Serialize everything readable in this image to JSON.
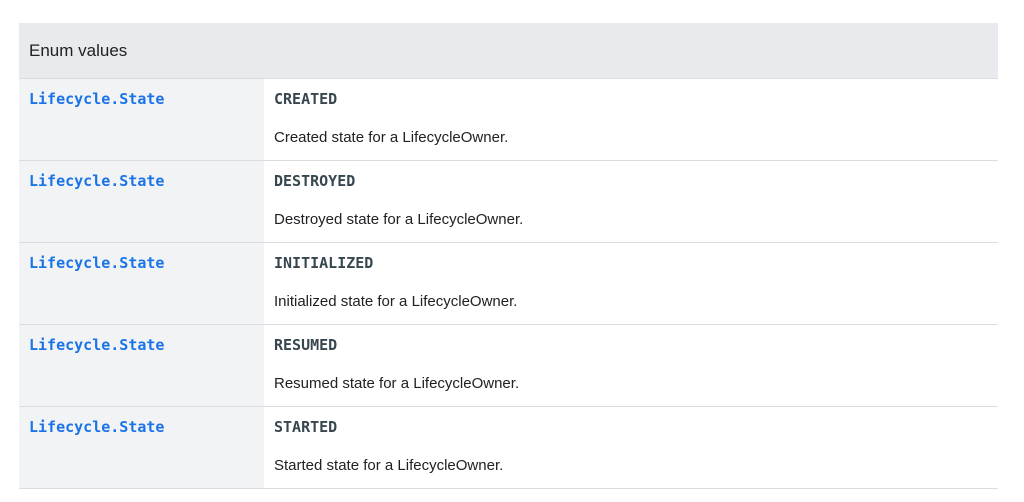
{
  "table": {
    "header": "Enum values",
    "rows": [
      {
        "type": "Lifecycle.State",
        "name": "CREATED",
        "description": "Created state for a LifecycleOwner."
      },
      {
        "type": "Lifecycle.State",
        "name": "DESTROYED",
        "description": "Destroyed state for a LifecycleOwner."
      },
      {
        "type": "Lifecycle.State",
        "name": "INITIALIZED",
        "description": "Initialized state for a LifecycleOwner."
      },
      {
        "type": "Lifecycle.State",
        "name": "RESUMED",
        "description": "Resumed state for a LifecycleOwner."
      },
      {
        "type": "Lifecycle.State",
        "name": "STARTED",
        "description": "Started state for a LifecycleOwner."
      }
    ]
  },
  "colors": {
    "link": "#1a73e8",
    "header_bg": "#e8eaed",
    "type_cell_bg": "#f1f3f4",
    "border": "#dadce0"
  }
}
